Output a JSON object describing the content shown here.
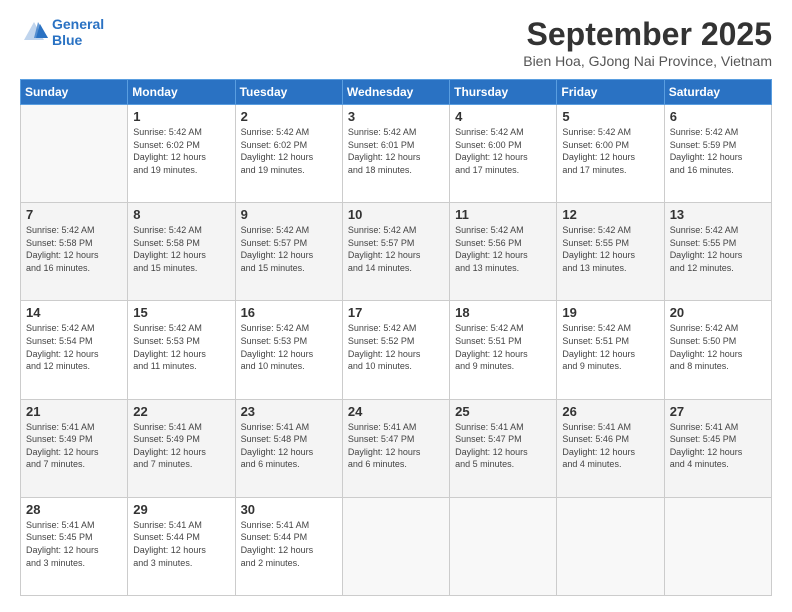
{
  "header": {
    "logo_line1": "General",
    "logo_line2": "Blue",
    "month": "September 2025",
    "location": "Bien Hoa, GJong Nai Province, Vietnam"
  },
  "days_of_week": [
    "Sunday",
    "Monday",
    "Tuesday",
    "Wednesday",
    "Thursday",
    "Friday",
    "Saturday"
  ],
  "weeks": [
    [
      {
        "day": "",
        "info": ""
      },
      {
        "day": "1",
        "info": "Sunrise: 5:42 AM\nSunset: 6:02 PM\nDaylight: 12 hours\nand 19 minutes."
      },
      {
        "day": "2",
        "info": "Sunrise: 5:42 AM\nSunset: 6:02 PM\nDaylight: 12 hours\nand 19 minutes."
      },
      {
        "day": "3",
        "info": "Sunrise: 5:42 AM\nSunset: 6:01 PM\nDaylight: 12 hours\nand 18 minutes."
      },
      {
        "day": "4",
        "info": "Sunrise: 5:42 AM\nSunset: 6:00 PM\nDaylight: 12 hours\nand 17 minutes."
      },
      {
        "day": "5",
        "info": "Sunrise: 5:42 AM\nSunset: 6:00 PM\nDaylight: 12 hours\nand 17 minutes."
      },
      {
        "day": "6",
        "info": "Sunrise: 5:42 AM\nSunset: 5:59 PM\nDaylight: 12 hours\nand 16 minutes."
      }
    ],
    [
      {
        "day": "7",
        "info": "Sunrise: 5:42 AM\nSunset: 5:58 PM\nDaylight: 12 hours\nand 16 minutes."
      },
      {
        "day": "8",
        "info": "Sunrise: 5:42 AM\nSunset: 5:58 PM\nDaylight: 12 hours\nand 15 minutes."
      },
      {
        "day": "9",
        "info": "Sunrise: 5:42 AM\nSunset: 5:57 PM\nDaylight: 12 hours\nand 15 minutes."
      },
      {
        "day": "10",
        "info": "Sunrise: 5:42 AM\nSunset: 5:57 PM\nDaylight: 12 hours\nand 14 minutes."
      },
      {
        "day": "11",
        "info": "Sunrise: 5:42 AM\nSunset: 5:56 PM\nDaylight: 12 hours\nand 13 minutes."
      },
      {
        "day": "12",
        "info": "Sunrise: 5:42 AM\nSunset: 5:55 PM\nDaylight: 12 hours\nand 13 minutes."
      },
      {
        "day": "13",
        "info": "Sunrise: 5:42 AM\nSunset: 5:55 PM\nDaylight: 12 hours\nand 12 minutes."
      }
    ],
    [
      {
        "day": "14",
        "info": "Sunrise: 5:42 AM\nSunset: 5:54 PM\nDaylight: 12 hours\nand 12 minutes."
      },
      {
        "day": "15",
        "info": "Sunrise: 5:42 AM\nSunset: 5:53 PM\nDaylight: 12 hours\nand 11 minutes."
      },
      {
        "day": "16",
        "info": "Sunrise: 5:42 AM\nSunset: 5:53 PM\nDaylight: 12 hours\nand 10 minutes."
      },
      {
        "day": "17",
        "info": "Sunrise: 5:42 AM\nSunset: 5:52 PM\nDaylight: 12 hours\nand 10 minutes."
      },
      {
        "day": "18",
        "info": "Sunrise: 5:42 AM\nSunset: 5:51 PM\nDaylight: 12 hours\nand 9 minutes."
      },
      {
        "day": "19",
        "info": "Sunrise: 5:42 AM\nSunset: 5:51 PM\nDaylight: 12 hours\nand 9 minutes."
      },
      {
        "day": "20",
        "info": "Sunrise: 5:42 AM\nSunset: 5:50 PM\nDaylight: 12 hours\nand 8 minutes."
      }
    ],
    [
      {
        "day": "21",
        "info": "Sunrise: 5:41 AM\nSunset: 5:49 PM\nDaylight: 12 hours\nand 7 minutes."
      },
      {
        "day": "22",
        "info": "Sunrise: 5:41 AM\nSunset: 5:49 PM\nDaylight: 12 hours\nand 7 minutes."
      },
      {
        "day": "23",
        "info": "Sunrise: 5:41 AM\nSunset: 5:48 PM\nDaylight: 12 hours\nand 6 minutes."
      },
      {
        "day": "24",
        "info": "Sunrise: 5:41 AM\nSunset: 5:47 PM\nDaylight: 12 hours\nand 6 minutes."
      },
      {
        "day": "25",
        "info": "Sunrise: 5:41 AM\nSunset: 5:47 PM\nDaylight: 12 hours\nand 5 minutes."
      },
      {
        "day": "26",
        "info": "Sunrise: 5:41 AM\nSunset: 5:46 PM\nDaylight: 12 hours\nand 4 minutes."
      },
      {
        "day": "27",
        "info": "Sunrise: 5:41 AM\nSunset: 5:45 PM\nDaylight: 12 hours\nand 4 minutes."
      }
    ],
    [
      {
        "day": "28",
        "info": "Sunrise: 5:41 AM\nSunset: 5:45 PM\nDaylight: 12 hours\nand 3 minutes."
      },
      {
        "day": "29",
        "info": "Sunrise: 5:41 AM\nSunset: 5:44 PM\nDaylight: 12 hours\nand 3 minutes."
      },
      {
        "day": "30",
        "info": "Sunrise: 5:41 AM\nSunset: 5:44 PM\nDaylight: 12 hours\nand 2 minutes."
      },
      {
        "day": "",
        "info": ""
      },
      {
        "day": "",
        "info": ""
      },
      {
        "day": "",
        "info": ""
      },
      {
        "day": "",
        "info": ""
      }
    ]
  ]
}
